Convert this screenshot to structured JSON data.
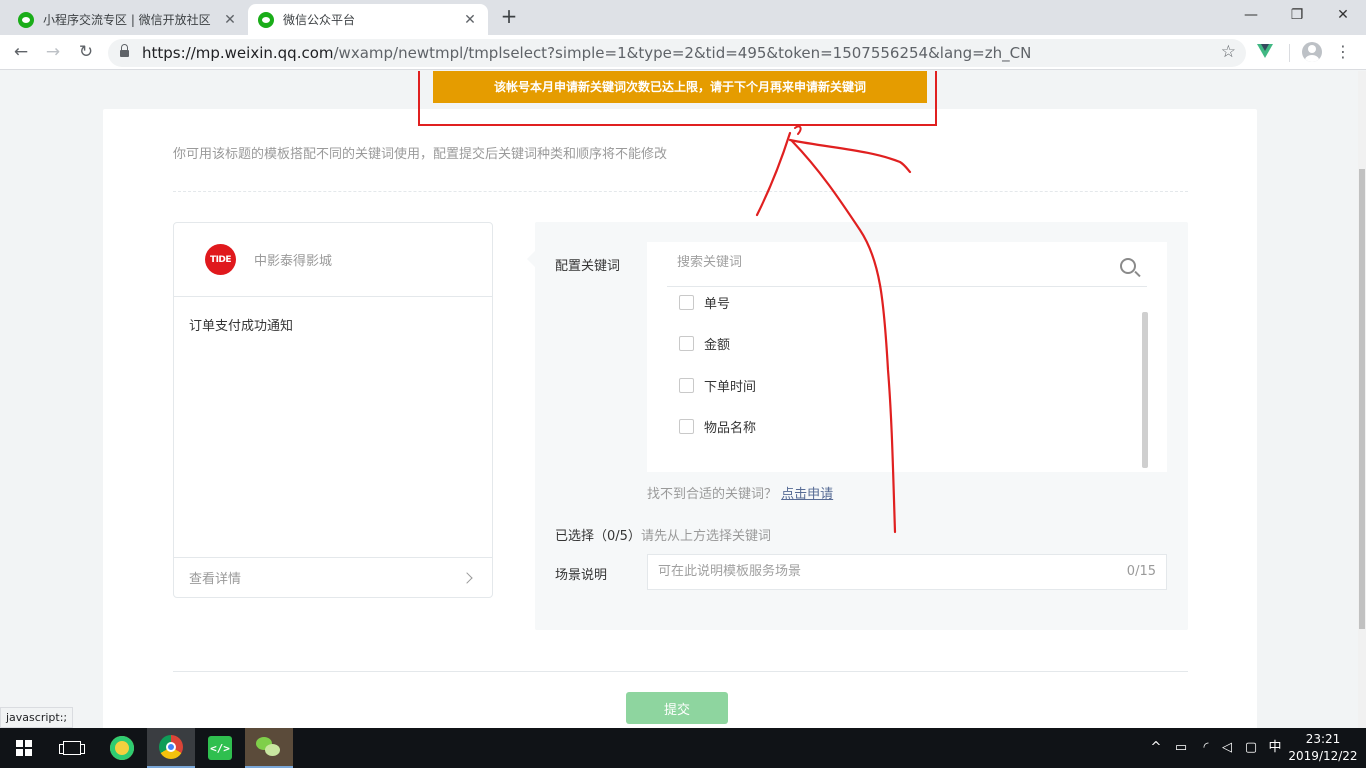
{
  "browser": {
    "tabs": [
      {
        "title": "小程序交流专区 | 微信开放社区"
      },
      {
        "title": "微信公众平台"
      }
    ],
    "new_tab": "+",
    "window_controls": {
      "minimize": "—",
      "restore": "❐",
      "close": "✕"
    },
    "url_host": "https://mp.weixin.qq.com",
    "url_path": "/wxamp/newtmpl/tmplselect?simple=1&type=2&tid=495&token=1507556254&lang=zh_CN",
    "status_text": "javascript:;"
  },
  "toast": {
    "message": "该帐号本月申请新关键词次数已达上限，请于下个月再来申请新关键词",
    "color": "#e59c00"
  },
  "page": {
    "hint": "你可用该标题的模板搭配不同的关键词使用，配置提交后关键词种类和顺序将不能修改",
    "preview": {
      "logo_text": "TIDE",
      "account_name": "中影泰得影城",
      "template_title": "订单支付成功通知",
      "detail_link": "查看详情"
    },
    "config": {
      "keywords_label": "配置关键词",
      "search_placeholder": "搜索关键词",
      "keywords": [
        {
          "label": "单号"
        },
        {
          "label": "金额"
        },
        {
          "label": "下单时间"
        },
        {
          "label": "物品名称"
        }
      ],
      "not_found_text": "找不到合适的关键词？",
      "apply_link": "点击申请",
      "selected_label": "已选择（0/5）",
      "selected_tip": "请先从上方选择关键词",
      "scene_label": "场景说明",
      "scene_placeholder": "可在此说明模板服务场景",
      "scene_counter": "0/15"
    },
    "submit_label": "提交",
    "submit_color": "#8ed59f"
  },
  "annotation_color": "#e02020",
  "taskbar": {
    "ime": "中",
    "time": "23:21",
    "date": "2019/12/22"
  }
}
